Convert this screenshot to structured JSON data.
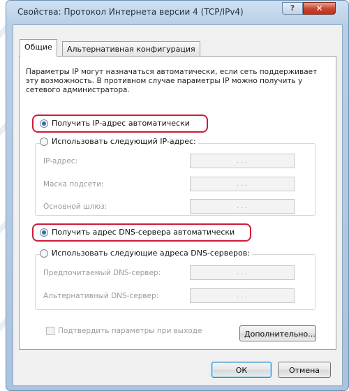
{
  "window": {
    "title": "Свойства: Протокол Интернета версии 4 (TCP/IPv4)",
    "close_label": "✕",
    "help_label": "?"
  },
  "tabs": [
    {
      "label": "Общие"
    },
    {
      "label": "Альтернативная конфигурация"
    }
  ],
  "description": "Параметры IP могут назначаться автоматически, если сеть поддерживает эту возможность. В противном случае параметры IP можно получить у сетевого администратора.",
  "ip": {
    "auto_label": "Получить IP-адрес автоматически",
    "manual_label": "Использовать следующий IP-адрес:",
    "selected": "auto",
    "fields": [
      {
        "label": "IP-адрес:",
        "value": ".  .  ."
      },
      {
        "label": "Маска подсети:",
        "value": ".  .  ."
      },
      {
        "label": "Основной шлюз:",
        "value": ".  .  ."
      }
    ]
  },
  "dns": {
    "auto_label": "Получить адрес DNS-сервера автоматически",
    "manual_label": "Использовать следующие адреса DNS-серверов:",
    "selected": "auto",
    "fields": [
      {
        "label": "Предпочитаемый DNS-сервер:",
        "value": ".  .  ."
      },
      {
        "label": "Альтернативный DNS-сервер:",
        "value": ".  .  ."
      }
    ]
  },
  "validate_label": "Подтвердить параметры при выходе",
  "validate_checked": false,
  "buttons": {
    "advanced": "Дополнительно...",
    "ok": "ОК",
    "cancel": "Отмена"
  },
  "colors": {
    "highlight": "#d01a3a",
    "radio_selected": "#2d6db5"
  }
}
